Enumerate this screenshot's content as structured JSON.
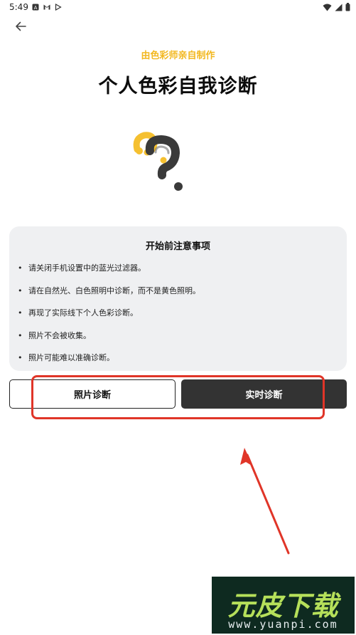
{
  "status_bar": {
    "time": "5:49",
    "left_icons": [
      "a-square-icon",
      "gmail-icon",
      "play-store-icon"
    ],
    "right_icons": [
      "wifi-icon",
      "signal-icon",
      "battery-icon"
    ]
  },
  "header": {
    "back_icon": "arrow-left-icon",
    "subtitle": "由色彩师亲自制作",
    "title": "个人色彩自我诊断"
  },
  "illustration": {
    "icon": "question-mark-illustration",
    "colors": {
      "dot": "#f5c030",
      "mark": "#3a3a3a"
    }
  },
  "notice": {
    "title": "开始前注意事项",
    "items": [
      "请关闭手机设置中的蓝光过滤器。",
      "请在自然光、白色照明中诊断，而不是黄色照明。",
      "再现了实际线下个人色彩诊断。",
      "照片不会被收集。",
      "照片可能难以准确诊断。"
    ],
    "bullet": "•"
  },
  "actions": {
    "photo_label": "照片诊断",
    "live_label": "实时诊断"
  },
  "annotation": {
    "color": "#e03528"
  },
  "watermark": {
    "logo": "元皮下载",
    "url": "www.yuanpi.com"
  },
  "colors": {
    "accent": "#f2b820",
    "primary_button": "#333333",
    "card_bg": "#eff0f2"
  }
}
